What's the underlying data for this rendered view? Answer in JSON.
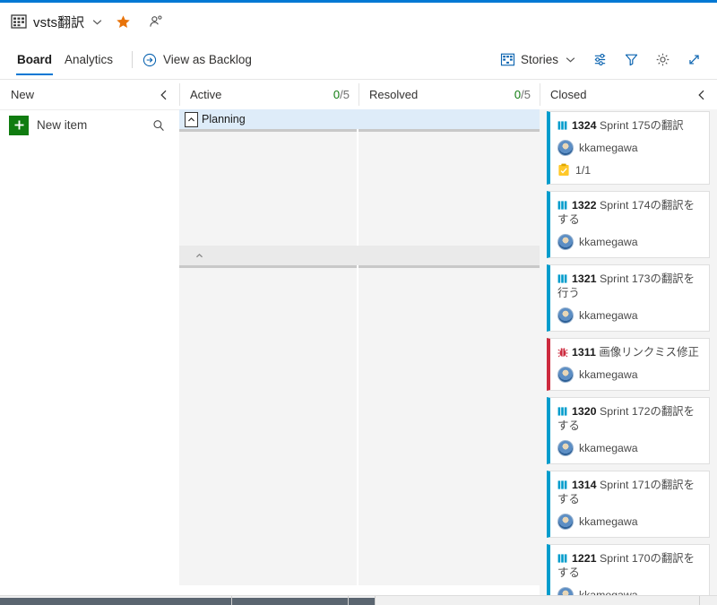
{
  "window": {
    "accent_color": "#0078d4"
  },
  "project_header": {
    "icon": "project-grid-icon",
    "name": "vsts翻訳",
    "chevron": "chevron-down-icon",
    "favorite": "star-icon",
    "team": "people-icon"
  },
  "command_bar": {
    "tabs": [
      {
        "label": "Board",
        "active": true
      },
      {
        "label": "Analytics",
        "active": false
      }
    ],
    "view_as_backlog": {
      "label": "View as Backlog",
      "icon": "arrow-right-circle-icon"
    },
    "right_items": [
      {
        "label": "Stories",
        "icon": "board-grid-icon",
        "chevron": "chevron-down-icon"
      },
      {
        "label": "",
        "icon": "settings-sliders-icon"
      },
      {
        "label": "",
        "icon": "filter-icon"
      },
      {
        "label": "",
        "icon": "gear-icon"
      },
      {
        "label": "",
        "icon": "fullscreen-icon"
      }
    ]
  },
  "board": {
    "columns": [
      {
        "name": "New",
        "wip_num": "",
        "wip_den": "",
        "collapse": true
      },
      {
        "name": "Active",
        "wip_num": "0",
        "wip_den": "/5",
        "collapse": false
      },
      {
        "name": "Resolved",
        "wip_num": "0",
        "wip_den": "/5",
        "collapse": false
      },
      {
        "name": "Closed",
        "wip_num": "",
        "wip_den": "",
        "collapse": true
      }
    ],
    "swimlanes": [
      {
        "name": "Planning",
        "caret": "caret-up-icon",
        "style": "planning"
      },
      {
        "name": "",
        "caret": "caret-up-icon",
        "style": "second"
      }
    ],
    "new_column": {
      "new_item_label": "New item",
      "plus_icon": "plus-icon",
      "search_icon": "search-icon"
    },
    "closed_cards": [
      {
        "type_icon": "story-icon",
        "id": "1324",
        "title": "Sprint 175の翻訳",
        "assignee": "kkamegawa",
        "checklist": "1/1",
        "checklist_icon": "checklist-icon",
        "kind": "story"
      },
      {
        "type_icon": "story-icon",
        "id": "1322",
        "title": "Sprint 174の翻訳をする",
        "assignee": "kkamegawa",
        "checklist": "",
        "kind": "story"
      },
      {
        "type_icon": "story-icon",
        "id": "1321",
        "title": "Sprint 173の翻訳を行う",
        "assignee": "kkamegawa",
        "checklist": "",
        "kind": "story"
      },
      {
        "type_icon": "bug-icon",
        "id": "1311",
        "title": "画像リンクミス修正",
        "assignee": "kkamegawa",
        "checklist": "",
        "kind": "bug"
      },
      {
        "type_icon": "story-icon",
        "id": "1320",
        "title": "Sprint 172の翻訳をする",
        "assignee": "kkamegawa",
        "checklist": "",
        "kind": "story"
      },
      {
        "type_icon": "story-icon",
        "id": "1314",
        "title": "Sprint 171の翻訳をする",
        "assignee": "kkamegawa",
        "checklist": "",
        "kind": "story"
      },
      {
        "type_icon": "story-icon",
        "id": "1221",
        "title": "Sprint 170の翻訳をする",
        "assignee": "kkamegawa",
        "checklist": "",
        "kind": "story"
      }
    ]
  },
  "colors": {
    "accent": "#0078d4",
    "story": "#009ccc",
    "bug": "#cc293d",
    "wip_ok": "#107c10",
    "new_item_green": "#107c10",
    "planning_lane": "#deecf9"
  }
}
